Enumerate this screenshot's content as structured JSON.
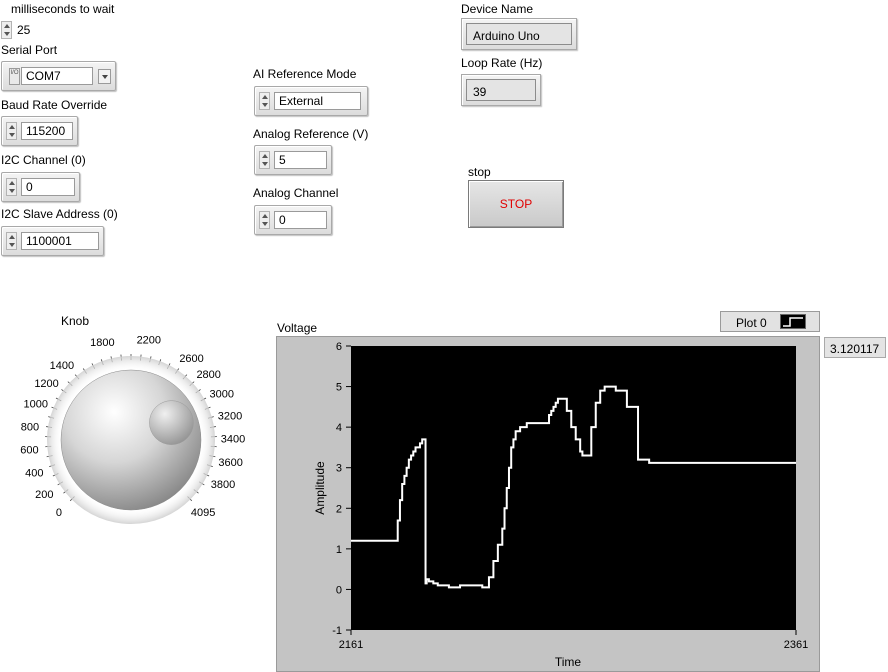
{
  "controls": {
    "ms_wait": {
      "label": "milliseconds to wait",
      "value": "25"
    },
    "serial_port": {
      "label": "Serial Port",
      "value": "COM7",
      "io_icon": "I/O"
    },
    "baud_rate": {
      "label": "Baud Rate Override",
      "value": "115200"
    },
    "i2c_channel": {
      "label": "I2C Channel (0)",
      "value": "0"
    },
    "i2c_slave": {
      "label": "I2C Slave Address (0)",
      "value": "1100001"
    },
    "ai_ref_mode": {
      "label": "AI Reference Mode",
      "value": "External"
    },
    "analog_ref": {
      "label": "Analog Reference (V)",
      "value": "5"
    },
    "analog_channel": {
      "label": "Analog Channel",
      "value": "0"
    }
  },
  "indicators": {
    "device_name": {
      "label": "Device Name",
      "value": "Arduino Uno"
    },
    "loop_rate": {
      "label": "Loop Rate (Hz)",
      "value": "39"
    }
  },
  "stop": {
    "label": "stop",
    "button_text": "STOP"
  },
  "knob": {
    "label": "Knob",
    "scale_labels": [
      "0",
      "200",
      "400",
      "600",
      "800",
      "1000",
      "1200",
      "1400",
      "1800",
      "2200",
      "2600",
      "2800",
      "3000",
      "3200",
      "3400",
      "3600",
      "3800",
      "4095"
    ],
    "min": 0,
    "max": 4095,
    "value": 3060
  },
  "graph": {
    "legend": "Plot 0",
    "digital_value": "3.120117"
  },
  "colors": {
    "stop_text": "#e00000",
    "plot_bg": "#000000",
    "trace": "#ffffff"
  },
  "chart_data": {
    "type": "line",
    "title": "Voltage",
    "xlabel": "Time",
    "ylabel": "Amplitude",
    "xlim": [
      2161,
      2361
    ],
    "ylim": [
      -1,
      6
    ],
    "xticks": [
      "2161",
      "2361"
    ],
    "yticks": [
      "-1",
      "0",
      "1",
      "2",
      "3",
      "4",
      "5",
      "6"
    ],
    "grid": false,
    "interpolation": "step",
    "series": [
      {
        "name": "Plot 0",
        "x": [
          2161,
          2181,
          2182,
          2183,
          2184,
          2185,
          2186,
          2187,
          2188,
          2189,
          2190,
          2191,
          2192,
          2193,
          2194,
          2194.5,
          2195,
          2196,
          2198,
          2200,
          2205,
          2210,
          2215,
          2220,
          2223,
          2225,
          2227,
          2229,
          2230,
          2231,
          2232,
          2233,
          2234,
          2235,
          2237,
          2240,
          2245,
          2250,
          2251,
          2252,
          2253,
          2254,
          2255,
          2256,
          2258,
          2260,
          2262,
          2264,
          2265,
          2267,
          2269,
          2271,
          2273,
          2275,
          2276,
          2278,
          2280,
          2285,
          2290,
          2295,
          2301,
          2361
        ],
        "y": [
          1.2,
          1.2,
          1.7,
          2.2,
          2.6,
          2.8,
          3.0,
          3.2,
          3.3,
          3.4,
          3.5,
          3.5,
          3.6,
          3.7,
          3.7,
          0.15,
          0.25,
          0.2,
          0.15,
          0.1,
          0.05,
          0.1,
          0.1,
          0.05,
          0.3,
          0.7,
          1.1,
          1.5,
          2.0,
          2.5,
          3.0,
          3.5,
          3.7,
          3.9,
          4.0,
          4.1,
          4.1,
          4.3,
          4.4,
          4.5,
          4.6,
          4.7,
          4.7,
          4.7,
          4.4,
          4.0,
          3.7,
          3.4,
          3.3,
          3.3,
          4.0,
          4.6,
          4.9,
          5.0,
          5.0,
          5.0,
          4.9,
          4.5,
          3.2,
          3.12,
          3.12,
          3.12
        ]
      }
    ]
  }
}
